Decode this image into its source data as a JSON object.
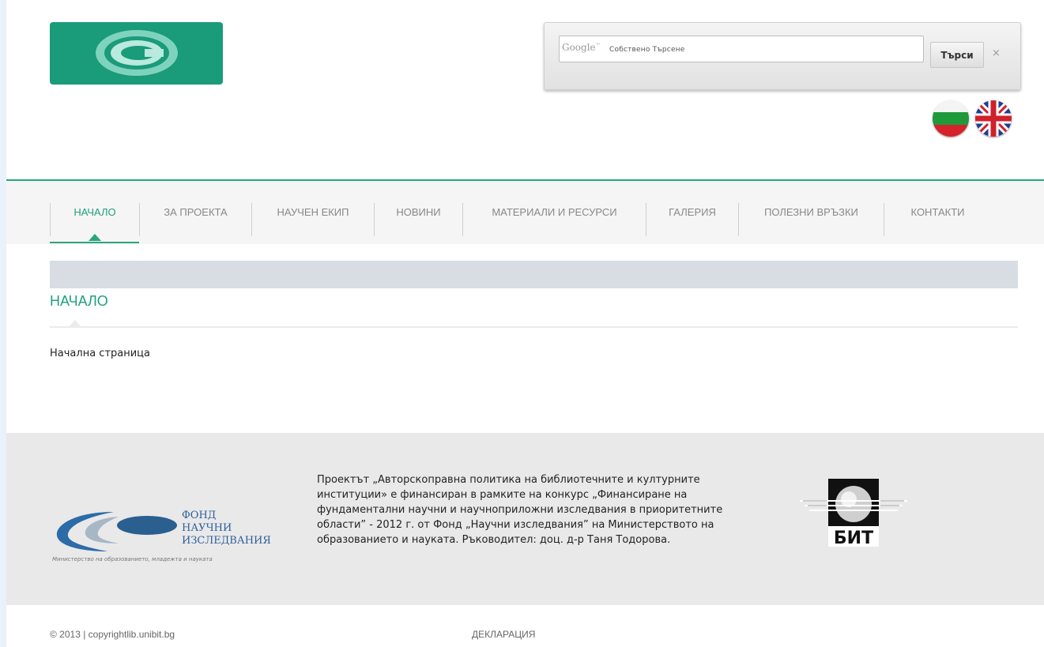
{
  "header": {
    "logo_icon": "copyright-icon",
    "search": {
      "brand": "Google",
      "placeholder": "Собствено Търсене",
      "button_label": "Търси",
      "clear_label": "×"
    },
    "languages": [
      {
        "code": "bg",
        "icon": "flag-bulgaria-icon"
      },
      {
        "code": "en",
        "icon": "flag-uk-icon"
      }
    ]
  },
  "nav": {
    "items": [
      {
        "label": "НАЧАЛО",
        "active": true
      },
      {
        "label": "ЗА ПРОЕКТА",
        "active": false
      },
      {
        "label": "НАУЧЕН ЕКИП",
        "active": false
      },
      {
        "label": "НОВИНИ",
        "active": false
      },
      {
        "label": "МАТЕРИАЛИ И РЕСУРСИ",
        "active": false
      },
      {
        "label": "ГАЛЕРИЯ",
        "active": false
      },
      {
        "label": "ПОЛЕЗНИ ВРЪЗКИ",
        "active": false
      },
      {
        "label": "КОНТАКТИ",
        "active": false
      }
    ]
  },
  "main": {
    "title": "НАЧАЛО",
    "body": "Начална страница"
  },
  "footer": {
    "fund_logo": {
      "line1": "ФОНД",
      "line2": "НАУЧНИ",
      "line3": "ИЗСЛЕДВАНИЯ",
      "subtitle": "Министерство на образованието, младежта и науката"
    },
    "text": "Проектът „Авторскоправна политика на библиотечните и културните институции» е финансиран в рамките на конкурс „Финансиране на фундаментални научни и научноприложни изследвания в приоритетните области” - 2012 г. от Фонд „Научни изследвания” на Министерството на образованието и науката. Ръководител: доц. д-р Таня Тодорова.",
    "bit_logo_text": "БИТ",
    "copyright": "© 2013 | copyrightlib.unibit.bg",
    "declaration": "ДЕКЛАРАЦИЯ"
  },
  "colors": {
    "accent": "#1fa07c",
    "logo_bg": "#1a9b7a",
    "footer_bg": "#e9e9e9"
  }
}
